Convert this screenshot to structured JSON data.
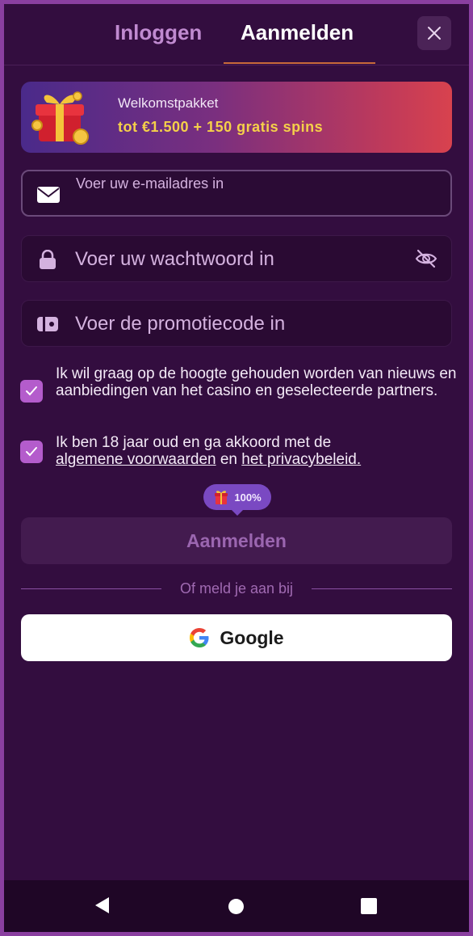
{
  "header": {
    "tabs": [
      {
        "label": "Inloggen",
        "active": false
      },
      {
        "label": "Aanmelden",
        "active": true
      }
    ],
    "close_icon": "close-icon"
  },
  "banner": {
    "title": "Welkomstpakket",
    "subtitle": "tot €1.500 + 150 gratis spins",
    "icon": "gift-box-icon"
  },
  "form": {
    "email": {
      "placeholder": "Voer uw e-mailadres in",
      "icon": "envelope-icon"
    },
    "password": {
      "placeholder": "Voer uw wachtwoord in",
      "icon": "lock-icon",
      "toggle_icon": "eye-off-icon"
    },
    "promo": {
      "placeholder": "Voer de promotiecode in",
      "icon": "ticket-icon"
    },
    "consents": [
      {
        "checked": true,
        "text": "Ik wil graag op de hoogte gehouden worden van nieuws en aanbiedingen van het casino en geselecteerde partners."
      },
      {
        "checked": true,
        "text_before": "Ik ben 18 jaar oud en ga akkoord met de",
        "link_terms": "algemene voorwaarden",
        "text_middle": "en",
        "link_privacy": "het privacybeleid."
      }
    ],
    "bonus_bubble": {
      "value": "100%",
      "icon": "gift-icon"
    },
    "submit_label": "Aanmelden",
    "divider_text": "Of meld je aan bij",
    "google_label": "Google"
  },
  "colors": {
    "background": "#330d3f",
    "accent": "#b45ccc",
    "banner_highlight": "#f5d049"
  },
  "navbar": {
    "back_icon": "back-triangle-icon",
    "home_icon": "home-circle-icon",
    "recents_icon": "recents-square-icon"
  }
}
